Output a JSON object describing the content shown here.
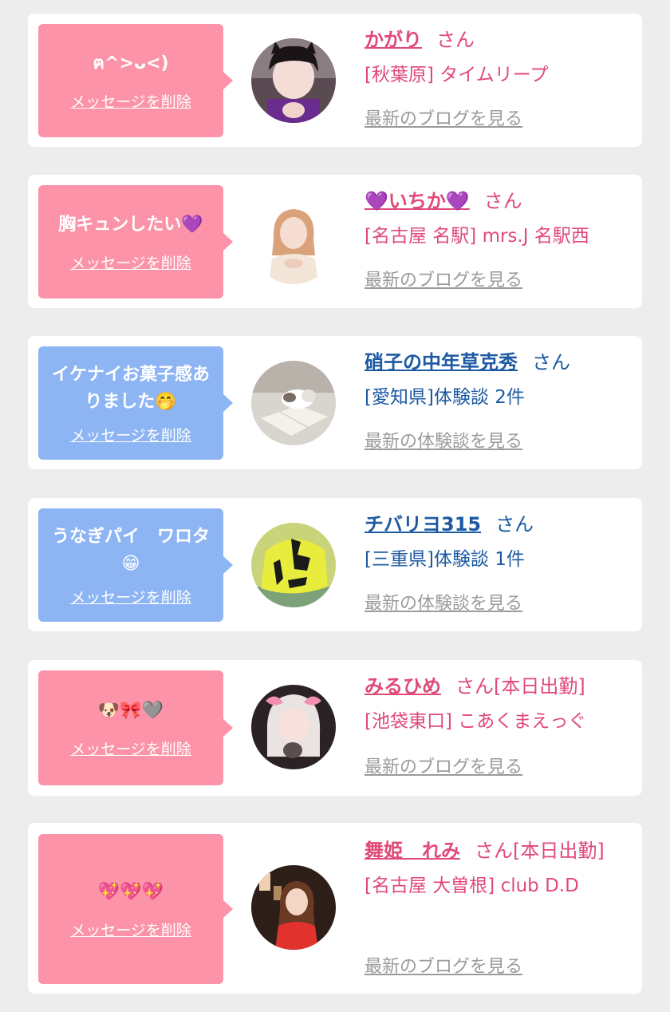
{
  "cards": [
    {
      "message": "ฅ^>ᴗ<)",
      "delete_label": "メッセージを削除",
      "name": "かがり",
      "honorific": "さん",
      "shop": "[秋葉原] タイムリープ",
      "link": "最新のブログを見る",
      "theme": "pink"
    },
    {
      "message": "胸キュンしたい💜",
      "delete_label": "メッセージを削除",
      "name": "💜いちか💜",
      "honorific": "さん",
      "shop": "[名古屋 名駅] mrs.J 名駅西",
      "link": "最新のブログを見る",
      "theme": "pink"
    },
    {
      "message": "イケナイお菓子感ありました🤭",
      "delete_label": "メッセージを削除",
      "name": "硝子の中年草克秀",
      "honorific": "さん",
      "shop": "[愛知県]体験談 2件",
      "link": "最新の体験談を見る",
      "theme": "blue"
    },
    {
      "message": "うなぎパイ　ワロタ😁",
      "delete_label": "メッセージを削除",
      "name": "チバリヨ315",
      "honorific": "さん",
      "shop": "[三重県]体験談 1件",
      "link": "最新の体験談を見る",
      "theme": "blue"
    },
    {
      "message": "🐶🎀🩶",
      "delete_label": "メッセージを削除",
      "name": "みるひめ",
      "honorific": "さん[本日出勤]",
      "shop": "[池袋東口] こあくまえっぐ",
      "link": "最新のブログを見る",
      "theme": "pink"
    },
    {
      "message": "💖💖💖",
      "delete_label": "メッセージを削除",
      "name": "舞姫　れみ",
      "honorific": "さん[本日出勤]",
      "shop": "[名古屋 大曽根] club D.D",
      "link": "最新のブログを見る",
      "theme": "pink"
    }
  ],
  "colors": {
    "pink_bubble": "#fc93a8",
    "blue_bubble": "#8db5f4",
    "pink_text": "#e04a78",
    "blue_text": "#1d5aa3",
    "link_gray": "#9b9b9b"
  }
}
